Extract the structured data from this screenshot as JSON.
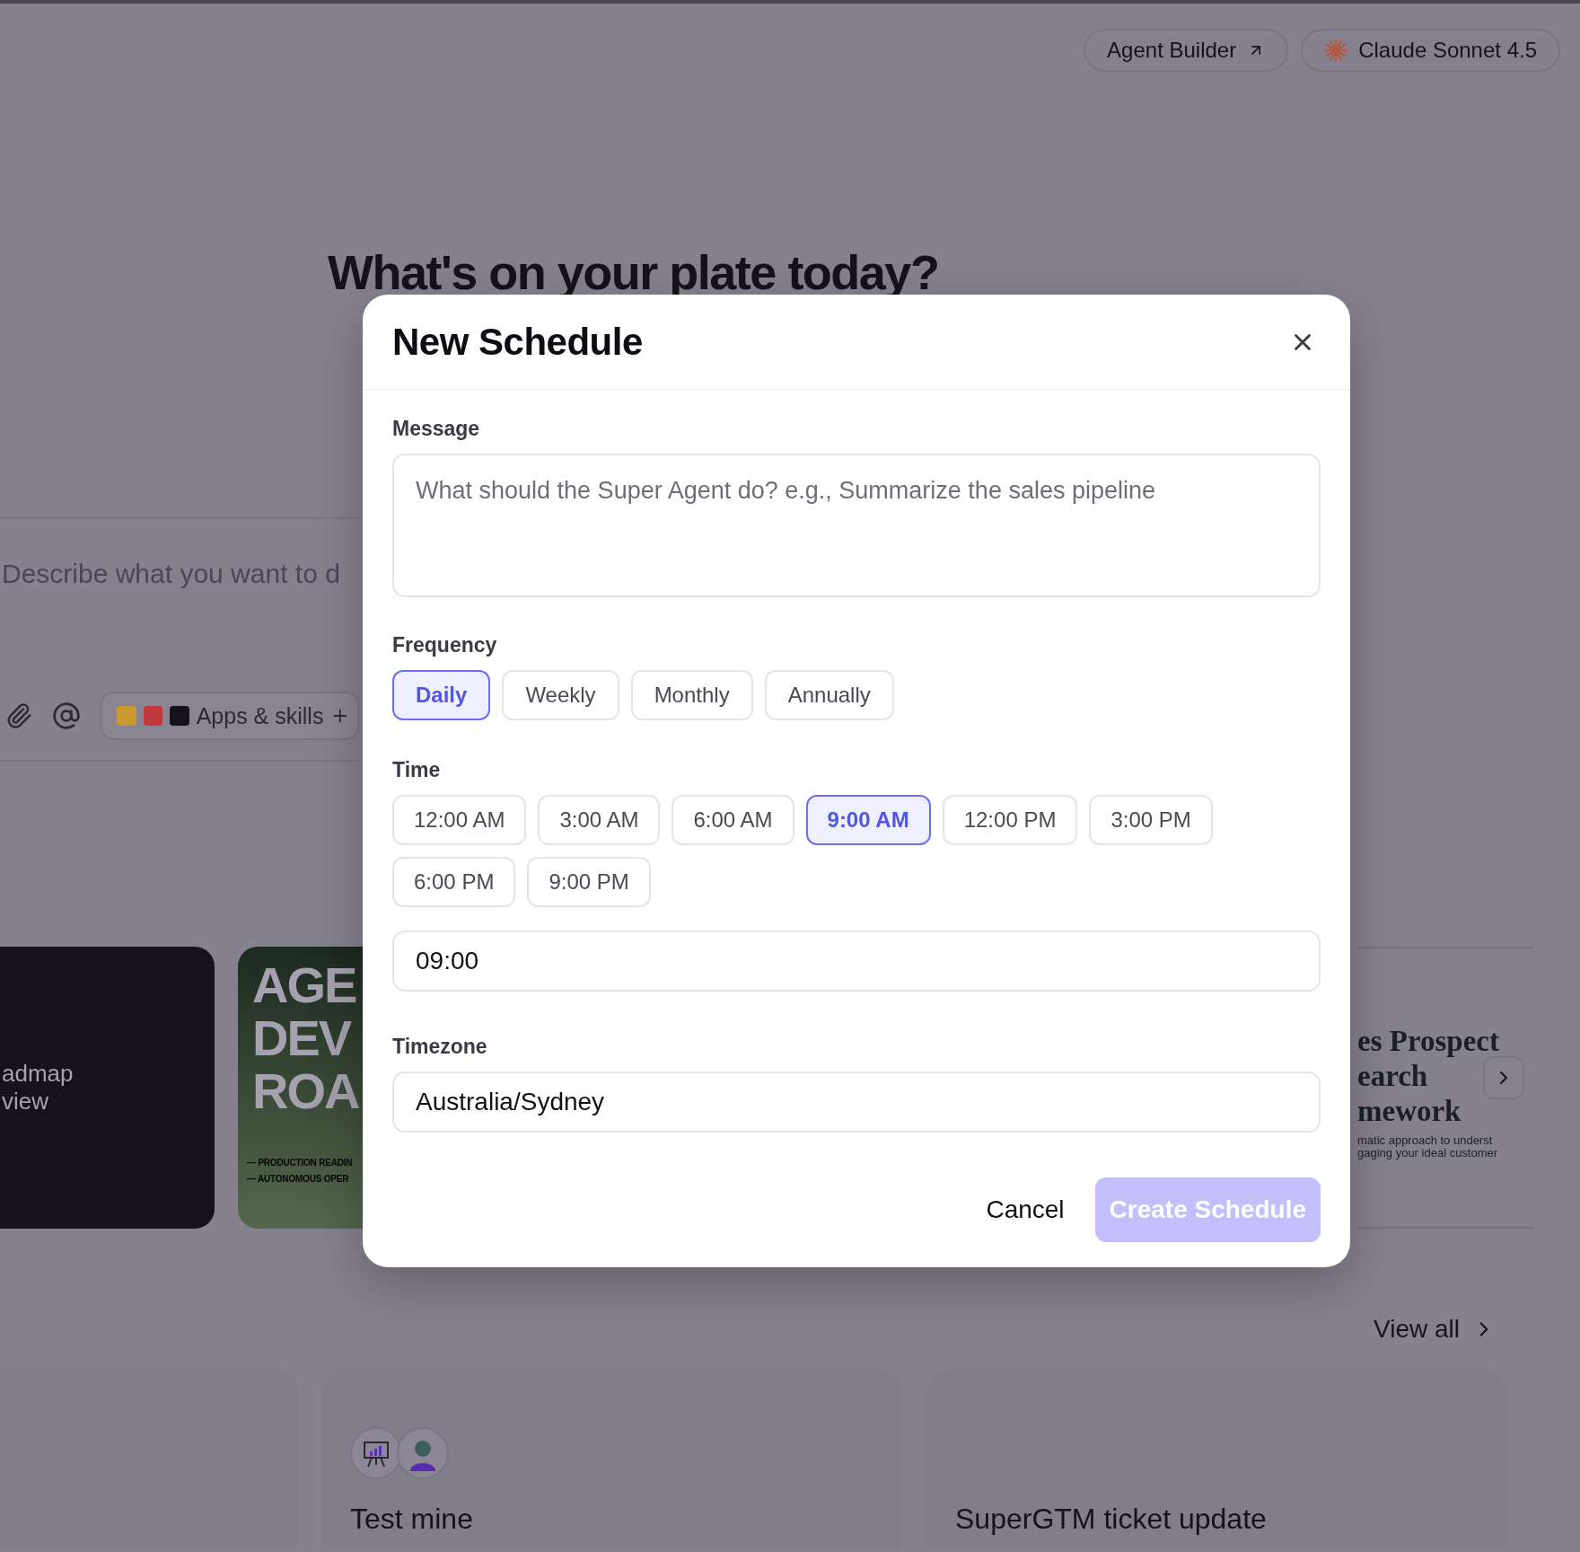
{
  "top_bar": {
    "agent_builder": "Agent Builder",
    "model": "Claude Sonnet 4.5"
  },
  "heading": "What's on your plate today?",
  "composer": {
    "placeholder": "Describe what you want to d",
    "apps_label": "Apps & skills"
  },
  "featured": [
    {
      "kind": "dark",
      "lines": [
        "admap",
        "view"
      ]
    },
    {
      "kind": "poster",
      "lines": [
        "AGE",
        "DEV",
        "ROA"
      ],
      "notes": [
        "— PRODUCTION READIN",
        "— AUTONOMOUS OPER"
      ]
    },
    {
      "kind": "article",
      "lines": [
        "es Prospect",
        "earch",
        "mework"
      ],
      "notes": [
        "matic approach to underst",
        "gaging your ideal customer"
      ]
    }
  ],
  "view_all": "View all",
  "recent": [
    {
      "title": "Test mine",
      "avatars": [
        {
          "kind": "presentation"
        },
        {
          "kind": "person"
        }
      ]
    },
    {
      "title": "SuperGTM ticket update"
    }
  ],
  "modal": {
    "title": "New Schedule",
    "message": {
      "label": "Message",
      "placeholder": "What should the Super Agent do? e.g., Summarize the sales pipeline"
    },
    "frequency": {
      "label": "Frequency",
      "options": [
        {
          "label": "Daily",
          "selected": true
        },
        {
          "label": "Weekly",
          "selected": false
        },
        {
          "label": "Monthly",
          "selected": false
        },
        {
          "label": "Annually",
          "selected": false
        }
      ]
    },
    "time": {
      "label": "Time",
      "options": [
        {
          "label": "12:00 AM",
          "selected": false
        },
        {
          "label": "3:00 AM",
          "selected": false
        },
        {
          "label": "6:00 AM",
          "selected": false
        },
        {
          "label": "9:00 AM",
          "selected": true
        },
        {
          "label": "12:00 PM",
          "selected": false
        },
        {
          "label": "3:00 PM",
          "selected": false
        },
        {
          "label": "6:00 PM",
          "selected": false
        },
        {
          "label": "9:00 PM",
          "selected": false
        }
      ],
      "value": "09:00"
    },
    "timezone": {
      "label": "Timezone",
      "value": "Australia/Sydney"
    },
    "cancel": "Cancel",
    "create": {
      "label": "Create Schedule",
      "disabled": true
    }
  }
}
